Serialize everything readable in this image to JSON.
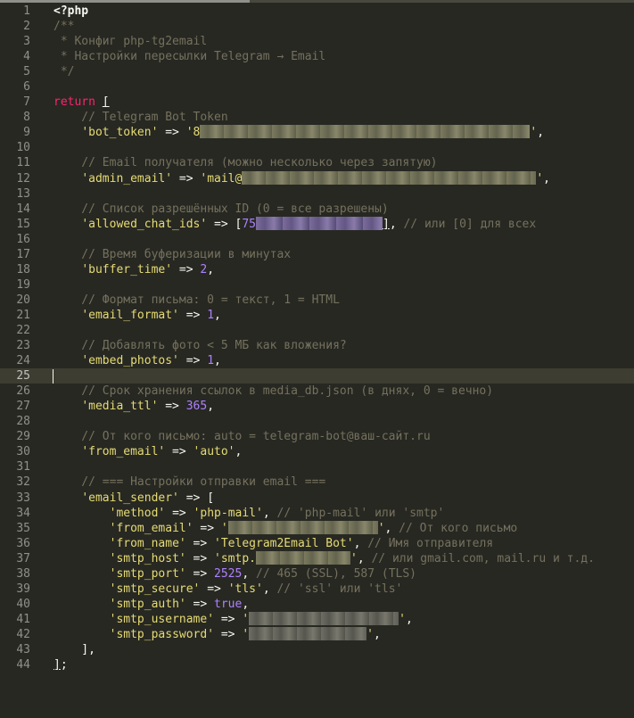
{
  "editor": {
    "theme_colors": {
      "background": "#272822",
      "comment": "#75715e",
      "string": "#e6db74",
      "number": "#ae81ff",
      "keyword": "#f92672",
      "text": "#f8f8f2",
      "line_number": "#90908a"
    },
    "current_line": 25,
    "lines": [
      {
        "n": "1",
        "segs": [
          {
            "t": "<?php",
            "c": "bold"
          }
        ]
      },
      {
        "n": "2",
        "segs": [
          {
            "t": "/**",
            "c": "comment"
          }
        ]
      },
      {
        "n": "3",
        "segs": [
          {
            "t": " * Конфиг php-tg2email",
            "c": "comment"
          }
        ]
      },
      {
        "n": "4",
        "segs": [
          {
            "t": " * Настройки пересылки Telegram → Email",
            "c": "comment"
          }
        ]
      },
      {
        "n": "5",
        "segs": [
          {
            "t": " */",
            "c": "comment"
          }
        ]
      },
      {
        "n": "6",
        "segs": []
      },
      {
        "n": "7",
        "segs": [
          {
            "t": "return",
            "c": "kw"
          },
          {
            "t": " ",
            "c": "plain"
          },
          {
            "t": "[",
            "c": "under"
          }
        ]
      },
      {
        "n": "8",
        "segs": [
          {
            "t": "    // Telegram Bot Token",
            "c": "comment"
          }
        ]
      },
      {
        "n": "9",
        "segs": [
          {
            "t": "    ",
            "c": "plain"
          },
          {
            "t": "'bot_token'",
            "c": "string"
          },
          {
            "t": " => ",
            "c": "plain"
          },
          {
            "t": "'8",
            "c": "string"
          },
          {
            "blur": 370,
            "k": "yellow"
          },
          {
            "t": "'",
            "c": "string"
          },
          {
            "t": ",",
            "c": "plain"
          }
        ]
      },
      {
        "n": "10",
        "segs": []
      },
      {
        "n": "11",
        "segs": [
          {
            "t": "    // Email получателя (можно несколько через запятую)",
            "c": "comment"
          }
        ]
      },
      {
        "n": "12",
        "segs": [
          {
            "t": "    ",
            "c": "plain"
          },
          {
            "t": "'admin_email'",
            "c": "string"
          },
          {
            "t": " => ",
            "c": "plain"
          },
          {
            "t": "'mail@",
            "c": "string"
          },
          {
            "blur": 330,
            "k": "yellow"
          },
          {
            "t": "'",
            "c": "string"
          },
          {
            "t": ",",
            "c": "plain"
          }
        ]
      },
      {
        "n": "13",
        "segs": []
      },
      {
        "n": "14",
        "segs": [
          {
            "t": "    // Список разрешённых ID (0 = все разрешены)",
            "c": "comment"
          }
        ]
      },
      {
        "n": "15",
        "segs": [
          {
            "t": "    ",
            "c": "plain"
          },
          {
            "t": "'allowed_chat_ids'",
            "c": "string"
          },
          {
            "t": " => [",
            "c": "plain"
          },
          {
            "t": "75",
            "c": "num"
          },
          {
            "blur": 142,
            "k": "purple"
          },
          {
            "t": "]",
            "c": "under"
          },
          {
            "t": ", ",
            "c": "plain"
          },
          {
            "t": "// или [0] для всех",
            "c": "comment"
          }
        ]
      },
      {
        "n": "16",
        "segs": []
      },
      {
        "n": "17",
        "segs": [
          {
            "t": "    // Время буферизации в минутах",
            "c": "comment"
          }
        ]
      },
      {
        "n": "18",
        "segs": [
          {
            "t": "    ",
            "c": "plain"
          },
          {
            "t": "'buffer_time'",
            "c": "string"
          },
          {
            "t": " => ",
            "c": "plain"
          },
          {
            "t": "2",
            "c": "num"
          },
          {
            "t": ",",
            "c": "plain"
          }
        ]
      },
      {
        "n": "19",
        "segs": []
      },
      {
        "n": "20",
        "segs": [
          {
            "t": "    // Формат письма: 0 = текст, 1 = HTML",
            "c": "comment"
          }
        ]
      },
      {
        "n": "21",
        "segs": [
          {
            "t": "    ",
            "c": "plain"
          },
          {
            "t": "'email_format'",
            "c": "string"
          },
          {
            "t": " => ",
            "c": "plain"
          },
          {
            "t": "1",
            "c": "num"
          },
          {
            "t": ",",
            "c": "plain"
          }
        ]
      },
      {
        "n": "22",
        "segs": []
      },
      {
        "n": "23",
        "segs": [
          {
            "t": "    // Добавлять фото < 5 МБ как вложения?",
            "c": "comment"
          }
        ]
      },
      {
        "n": "24",
        "segs": [
          {
            "t": "    ",
            "c": "plain"
          },
          {
            "t": "'embed_photos'",
            "c": "string"
          },
          {
            "t": " => ",
            "c": "plain"
          },
          {
            "t": "1",
            "c": "num"
          },
          {
            "t": ",",
            "c": "plain"
          }
        ]
      },
      {
        "n": "25",
        "segs": []
      },
      {
        "n": "26",
        "segs": [
          {
            "t": "    // Срок хранения ссылок в media_db.json (в днях, 0 = вечно)",
            "c": "comment"
          }
        ]
      },
      {
        "n": "27",
        "segs": [
          {
            "t": "    ",
            "c": "plain"
          },
          {
            "t": "'media_ttl'",
            "c": "string"
          },
          {
            "t": " => ",
            "c": "plain"
          },
          {
            "t": "365",
            "c": "num"
          },
          {
            "t": ",",
            "c": "plain"
          }
        ]
      },
      {
        "n": "28",
        "segs": []
      },
      {
        "n": "29",
        "segs": [
          {
            "t": "    // От кого письмо: auto = telegram-bot@ваш-сайт.ru",
            "c": "comment"
          }
        ]
      },
      {
        "n": "30",
        "segs": [
          {
            "t": "    ",
            "c": "plain"
          },
          {
            "t": "'from_email'",
            "c": "string"
          },
          {
            "t": " => ",
            "c": "plain"
          },
          {
            "t": "'auto'",
            "c": "string"
          },
          {
            "t": ",",
            "c": "plain"
          }
        ]
      },
      {
        "n": "31",
        "segs": []
      },
      {
        "n": "32",
        "segs": [
          {
            "t": "    // === Настройки отправки email ===",
            "c": "comment"
          }
        ]
      },
      {
        "n": "33",
        "segs": [
          {
            "t": "    ",
            "c": "plain"
          },
          {
            "t": "'email_sender'",
            "c": "string"
          },
          {
            "t": " => [",
            "c": "plain"
          }
        ]
      },
      {
        "n": "34",
        "segs": [
          {
            "t": "        ",
            "c": "plain"
          },
          {
            "t": "'method'",
            "c": "string"
          },
          {
            "t": " => ",
            "c": "plain"
          },
          {
            "t": "'php-mail'",
            "c": "string"
          },
          {
            "t": ", ",
            "c": "plain"
          },
          {
            "t": "// 'php-mail' или 'smtp'",
            "c": "comment"
          }
        ]
      },
      {
        "n": "35",
        "segs": [
          {
            "t": "        ",
            "c": "plain"
          },
          {
            "t": "'from_email'",
            "c": "string"
          },
          {
            "t": " => ",
            "c": "plain"
          },
          {
            "t": "'",
            "c": "string"
          },
          {
            "blur": 168,
            "k": "yellow"
          },
          {
            "t": "'",
            "c": "string"
          },
          {
            "t": ", ",
            "c": "plain"
          },
          {
            "t": "// От кого письмо",
            "c": "comment"
          }
        ]
      },
      {
        "n": "36",
        "segs": [
          {
            "t": "        ",
            "c": "plain"
          },
          {
            "t": "'from_name'",
            "c": "string"
          },
          {
            "t": " => ",
            "c": "plain"
          },
          {
            "t": "'Telegram2Email Bot'",
            "c": "string"
          },
          {
            "t": ", ",
            "c": "plain"
          },
          {
            "t": "// Имя отправителя",
            "c": "comment"
          }
        ]
      },
      {
        "n": "37",
        "segs": [
          {
            "t": "        ",
            "c": "plain"
          },
          {
            "t": "'smtp_host'",
            "c": "string"
          },
          {
            "t": " => ",
            "c": "plain"
          },
          {
            "t": "'smtp.",
            "c": "string"
          },
          {
            "blur": 106,
            "k": "yellow"
          },
          {
            "t": "'",
            "c": "string"
          },
          {
            "t": ", ",
            "c": "plain"
          },
          {
            "t": "// или gmail.com, mail.ru и т.д.",
            "c": "comment"
          }
        ]
      },
      {
        "n": "38",
        "segs": [
          {
            "t": "        ",
            "c": "plain"
          },
          {
            "t": "'smtp_port'",
            "c": "string"
          },
          {
            "t": " => ",
            "c": "plain"
          },
          {
            "t": "2525",
            "c": "num"
          },
          {
            "t": ", ",
            "c": "plain"
          },
          {
            "t": "// 465 (SSL), 587 (TLS)",
            "c": "comment"
          }
        ]
      },
      {
        "n": "39",
        "segs": [
          {
            "t": "        ",
            "c": "plain"
          },
          {
            "t": "'smtp_secure'",
            "c": "string"
          },
          {
            "t": " => ",
            "c": "plain"
          },
          {
            "t": "'tls'",
            "c": "string"
          },
          {
            "t": ", ",
            "c": "plain"
          },
          {
            "t": "// 'ssl' или 'tls'",
            "c": "comment"
          }
        ]
      },
      {
        "n": "40",
        "segs": [
          {
            "t": "        ",
            "c": "plain"
          },
          {
            "t": "'smtp_auth'",
            "c": "string"
          },
          {
            "t": " => ",
            "c": "plain"
          },
          {
            "t": "true",
            "c": "num"
          },
          {
            "t": ",",
            "c": "plain"
          }
        ]
      },
      {
        "n": "41",
        "segs": [
          {
            "t": "        ",
            "c": "plain"
          },
          {
            "t": "'smtp_username'",
            "c": "string"
          },
          {
            "t": " => ",
            "c": "plain"
          },
          {
            "t": "'",
            "c": "string"
          },
          {
            "blur": 168,
            "k": "gray"
          },
          {
            "t": "'",
            "c": "string"
          },
          {
            "t": ",",
            "c": "plain"
          }
        ]
      },
      {
        "n": "42",
        "segs": [
          {
            "t": "        ",
            "c": "plain"
          },
          {
            "t": "'smtp_password'",
            "c": "string"
          },
          {
            "t": " => ",
            "c": "plain"
          },
          {
            "t": "'",
            "c": "string"
          },
          {
            "blur": 132,
            "k": "gray"
          },
          {
            "t": "'",
            "c": "string"
          },
          {
            "t": ",",
            "c": "plain"
          }
        ]
      },
      {
        "n": "43",
        "segs": [
          {
            "t": "    ],",
            "c": "plain"
          }
        ]
      },
      {
        "n": "44",
        "segs": [
          {
            "t": "]",
            "c": "under"
          },
          {
            "t": ";",
            "c": "plain"
          }
        ]
      }
    ]
  }
}
